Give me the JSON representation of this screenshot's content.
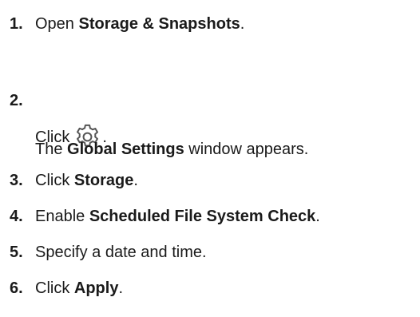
{
  "steps": [
    {
      "num": "1.",
      "pre": "Open ",
      "bold": "Storage & Snapshots",
      "post": "."
    },
    {
      "num": "2.",
      "pre": "Click ",
      "icon": "gear-icon",
      "post": ".",
      "result_pre": "The ",
      "result_bold": "Global Settings",
      "result_post": " window appears."
    },
    {
      "num": "3.",
      "pre": "Click ",
      "bold": "Storage",
      "post": "."
    },
    {
      "num": "4.",
      "pre": "Enable ",
      "bold": "Scheduled File System Check",
      "post": "."
    },
    {
      "num": "5.",
      "text": "Specify a date and time."
    },
    {
      "num": "6.",
      "pre": "Click ",
      "bold": "Apply",
      "post": "."
    }
  ]
}
